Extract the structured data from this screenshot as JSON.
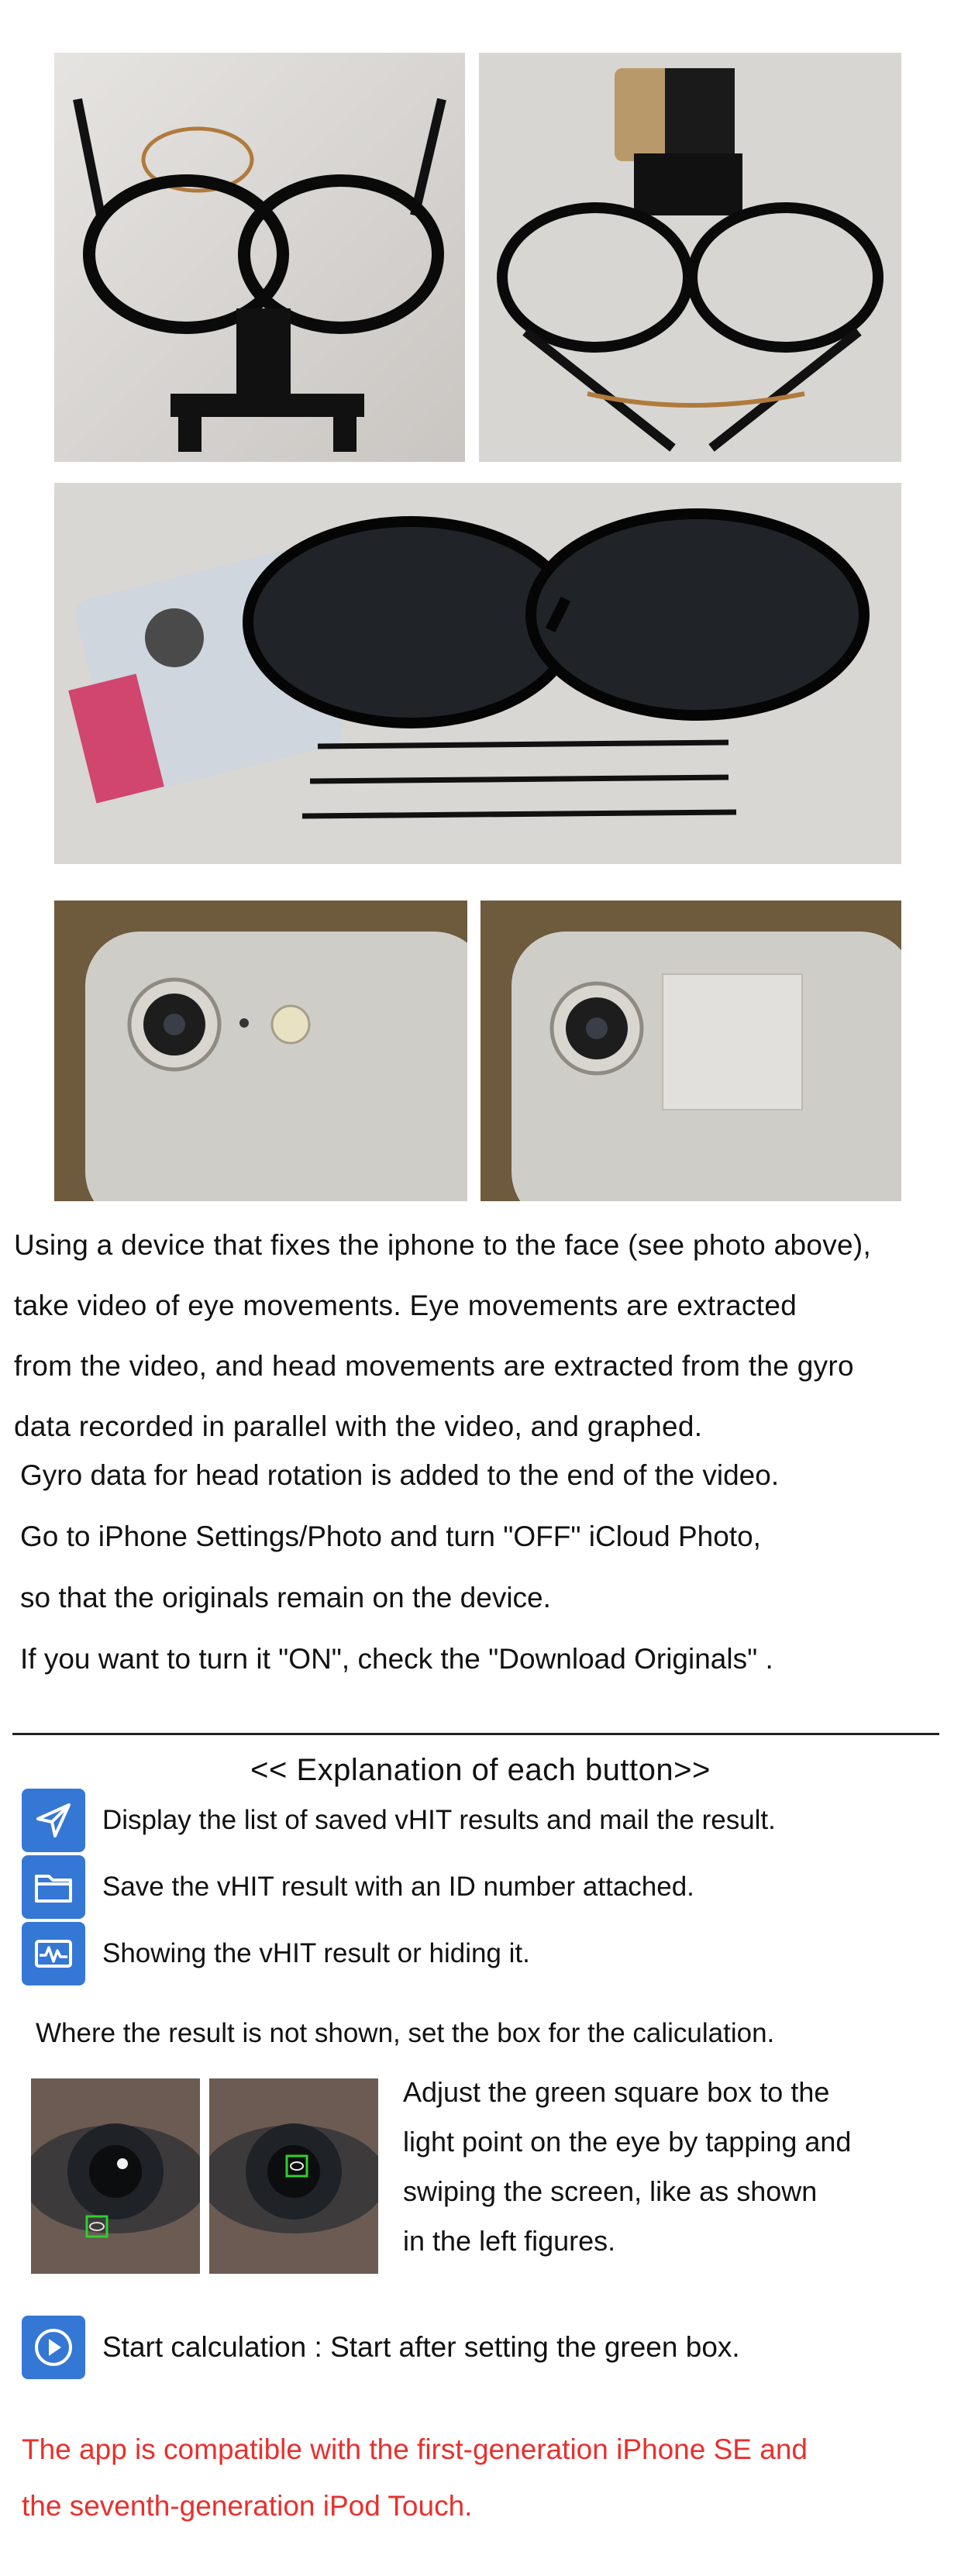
{
  "photos": {
    "glasses_frame": "glasses-frame-with-mount-photo",
    "glasses_mounted": "glasses-with-phone-mounted-photo",
    "sunglasses": "sunglasses-and-cable-ties-photo",
    "phone_camera": "phone-rear-camera-photo",
    "phone_camera_covered": "phone-rear-camera-covered-photo"
  },
  "intro": {
    "lines": [
      "Using a device that fixes the iphone to the face (see photo above),",
      "take video of eye movements.  Eye movements are extracted",
      "from the video, and head movements are extracted from the gyro",
      "data recorded in parallel with the video, and graphed."
    ]
  },
  "gyro_note": {
    "lines": [
      "Gyro data for head rotation is added to the end of the video.",
      "Go to iPhone Settings/Photo and turn \"OFF\" iCloud Photo,",
      "so that  the originals remain on the device.",
      "If you want to turn it \"ON\",  check the \"Download Originals\" ."
    ]
  },
  "explanation": {
    "title": "<< Explanation of each button>>",
    "buttons": [
      {
        "icon": "send-icon",
        "label": "Display the list of saved vHIT results and mail the result."
      },
      {
        "icon": "folder-icon",
        "label": "Save the vHIT result with an ID number attached."
      },
      {
        "icon": "waveform-icon",
        "label": "Showing the vHIT result or hiding it."
      }
    ],
    "box_note": "Where the result is not shown, set the box for the caliculation.",
    "adjust_lines": [
      "Adjust the green square box to the",
      "light point on the eye by tapping and",
      "swiping the screen, like as shown",
      "in the left figures."
    ],
    "start": {
      "icon": "play-icon",
      "label": "Start calculation : Start after setting the green box."
    }
  },
  "compatibility": {
    "color": "#e8302d",
    "lines": [
      "The app is compatible with the first-generation iPhone SE and",
      "the seventh-generation iPod Touch."
    ]
  },
  "colors": {
    "accent": "#3577d4",
    "box_green": "#2fd02f"
  }
}
